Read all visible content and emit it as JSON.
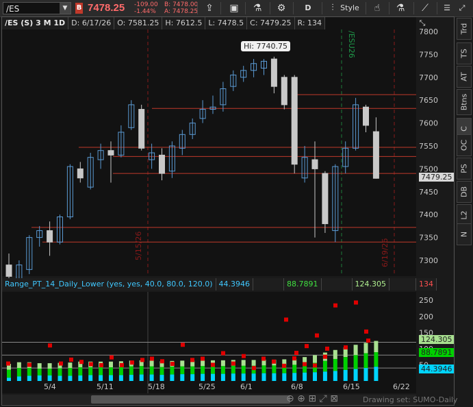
{
  "toolbar": {
    "symbol": "/ES",
    "badge": "B",
    "last": "7478.25",
    "change": "-109.00",
    "change_pct": "-1.44%",
    "bid": "B: 7478.00",
    "ask": "A: 7478.25",
    "period": "D",
    "style": "Style"
  },
  "info": {
    "symbol": "/ES (S) 3 M 1D",
    "date": "D: 6/17/26",
    "open": "O: 7581.25",
    "high": "H: 7612.5",
    "low": "L: 7478.5",
    "close": "C: 7479.25",
    "range": "R: 134"
  },
  "hi_label": "Hi: 7740.75",
  "last_price_tag": "7479.25",
  "y_axis": [
    "7800",
    "7750",
    "7700",
    "7650",
    "7600",
    "7550",
    "7500",
    "7450",
    "7400",
    "7350",
    "7300"
  ],
  "x_axis": [
    "5/4",
    "5/11",
    "5/18",
    "5/25",
    "6/1",
    "6/8",
    "6/15",
    "6/22"
  ],
  "annotations": {
    "left_date": "5/15/26",
    "right_date": "6/19/26",
    "expiry": "/ESU26"
  },
  "lower": {
    "study": "Range_PT_14_Daily_Lower (yes, yes, 40.0, 80.0, 120.0)",
    "v1": "44.3946",
    "v2": "88.7891",
    "v3": "124.305",
    "v4": "134",
    "y_axis": [
      "250",
      "200",
      "150",
      "100",
      "50"
    ],
    "label1": "124.305",
    "label2": "88.7891",
    "label3": "44.3946"
  },
  "side_tabs": [
    "Trd",
    "TS",
    "AT",
    "Btns",
    "C",
    "OC",
    "PS",
    "DB",
    "L2",
    "N"
  ],
  "drawing_set": "Drawing set: SUMO-Daily",
  "colors": {
    "up_candle": "#5b9bd5",
    "down_candle": "#c8c8c8",
    "resistance": "#c0392b",
    "cyan": "#00d5ff",
    "green": "#00d000",
    "light_green": "#a8e090",
    "red_dot": "#e00000"
  },
  "chart_data": {
    "type": "candlestick",
    "ylim": [
      7260,
      7810
    ],
    "candles": [
      {
        "o": 7290,
        "h": 7315,
        "l": 7260,
        "c": 7265
      },
      {
        "o": 7260,
        "h": 7300,
        "l": 7250,
        "c": 7290
      },
      {
        "o": 7280,
        "h": 7355,
        "l": 7270,
        "c": 7350
      },
      {
        "o": 7350,
        "h": 7375,
        "l": 7330,
        "c": 7365
      },
      {
        "o": 7365,
        "h": 7385,
        "l": 7310,
        "c": 7340
      },
      {
        "o": 7340,
        "h": 7400,
        "l": 7335,
        "c": 7395
      },
      {
        "o": 7395,
        "h": 7510,
        "l": 7390,
        "c": 7505
      },
      {
        "o": 7500,
        "h": 7515,
        "l": 7470,
        "c": 7480
      },
      {
        "o": 7460,
        "h": 7535,
        "l": 7455,
        "c": 7525
      },
      {
        "o": 7520,
        "h": 7555,
        "l": 7500,
        "c": 7540
      },
      {
        "o": 7540,
        "h": 7560,
        "l": 7470,
        "c": 7530
      },
      {
        "o": 7530,
        "h": 7595,
        "l": 7525,
        "c": 7580
      },
      {
        "o": 7590,
        "h": 7650,
        "l": 7585,
        "c": 7640
      },
      {
        "o": 7630,
        "h": 7640,
        "l": 7540,
        "c": 7545
      },
      {
        "o": 7520,
        "h": 7555,
        "l": 7500,
        "c": 7535
      },
      {
        "o": 7530,
        "h": 7545,
        "l": 7475,
        "c": 7490
      },
      {
        "o": 7495,
        "h": 7560,
        "l": 7480,
        "c": 7550
      },
      {
        "o": 7545,
        "h": 7585,
        "l": 7530,
        "c": 7575
      },
      {
        "o": 7575,
        "h": 7610,
        "l": 7565,
        "c": 7600
      },
      {
        "o": 7610,
        "h": 7650,
        "l": 7600,
        "c": 7630
      },
      {
        "o": 7630,
        "h": 7660,
        "l": 7620,
        "c": 7635
      },
      {
        "o": 7640,
        "h": 7690,
        "l": 7625,
        "c": 7675
      },
      {
        "o": 7680,
        "h": 7715,
        "l": 7670,
        "c": 7705
      },
      {
        "o": 7700,
        "h": 7725,
        "l": 7690,
        "c": 7715
      },
      {
        "o": 7715,
        "h": 7740,
        "l": 7700,
        "c": 7730
      },
      {
        "o": 7720,
        "h": 7740,
        "l": 7705,
        "c": 7735
      },
      {
        "o": 7740,
        "h": 7745,
        "l": 7665,
        "c": 7680
      },
      {
        "o": 7700,
        "h": 7705,
        "l": 7630,
        "c": 7640
      },
      {
        "o": 7700,
        "h": 7705,
        "l": 7490,
        "c": 7510
      },
      {
        "o": 7480,
        "h": 7550,
        "l": 7470,
        "c": 7525
      },
      {
        "o": 7520,
        "h": 7560,
        "l": 7350,
        "c": 7500
      },
      {
        "o": 7490,
        "h": 7495,
        "l": 7360,
        "c": 7380
      },
      {
        "o": 7365,
        "h": 7510,
        "l": 7340,
        "c": 7505
      },
      {
        "o": 7505,
        "h": 7560,
        "l": 7490,
        "c": 7545
      },
      {
        "o": 7545,
        "h": 7655,
        "l": 7540,
        "c": 7640
      },
      {
        "o": 7635,
        "h": 7640,
        "l": 7580,
        "c": 7595
      },
      {
        "o": 7581.25,
        "h": 7612.5,
        "l": 7478.5,
        "c": 7479.25
      }
    ],
    "levels": [
      7662,
      7632,
      7547,
      7527,
      7490,
      7372,
      7340
    ],
    "lower": {
      "ylim": [
        0,
        270
      ],
      "cyan": [
        10,
        14,
        16,
        17,
        17,
        16,
        16,
        17,
        18,
        18,
        18,
        18,
        19,
        20,
        20,
        19,
        20,
        21,
        21,
        22,
        22,
        22,
        23,
        23,
        23,
        24,
        24,
        24,
        25,
        26,
        27,
        29,
        31,
        34,
        37,
        40,
        44
      ],
      "green": [
        35,
        40,
        40,
        38,
        38,
        39,
        40,
        42,
        42,
        42,
        42,
        43,
        45,
        46,
        45,
        43,
        44,
        45,
        45,
        46,
        46,
        46,
        47,
        47,
        47,
        48,
        48,
        49,
        50,
        52,
        56,
        62,
        68,
        74,
        80,
        86,
        89
      ],
      "light_green": [
        53,
        58,
        58,
        55,
        55,
        56,
        57,
        60,
        60,
        60,
        60,
        61,
        63,
        64,
        63,
        61,
        62,
        63,
        63,
        64,
        64,
        64,
        65,
        65,
        65,
        66,
        66,
        67,
        68,
        74,
        80,
        88,
        96,
        104,
        112,
        118,
        124
      ],
      "red": [
        54,
        50,
        110,
        54,
        66,
        59,
        52,
        49,
        73,
        49,
        57,
        65,
        69,
        61,
        53,
        112,
        65,
        69,
        50,
        86,
        54,
        77,
        40,
        69,
        60,
        47,
        70,
        52,
        48,
        75,
        234,
        104,
        243,
        153,
        190,
        87,
        108,
        141,
        100,
        125
      ]
    }
  }
}
